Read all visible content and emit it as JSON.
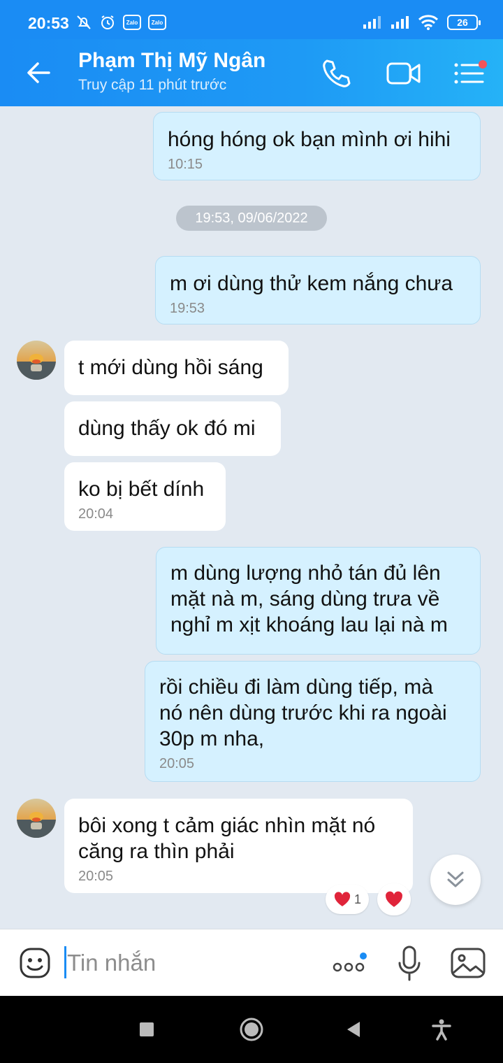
{
  "status_bar": {
    "time": "20:53",
    "app_badges": [
      "Zalo",
      "Zalo"
    ],
    "battery": "26"
  },
  "header": {
    "contact_name": "Phạm Thị Mỹ Ngân",
    "status": "Truy cập 11 phút trước",
    "icons": [
      "back-arrow-icon",
      "phone-call-icon",
      "video-call-icon",
      "menu-icon"
    ],
    "accent_color": "#1a8cf4",
    "notification_dot_color": "#f2545b"
  },
  "messages": [
    {
      "direction": "sent",
      "text": "hóng hóng ok bạn mình ơi hihi",
      "time": "10:15"
    },
    {
      "direction": "divider",
      "text": "19:53, 09/06/2022"
    },
    {
      "direction": "sent",
      "text": "m ơi dùng thử kem nắng chưa",
      "time": "19:53"
    },
    {
      "direction": "received",
      "text": "t mới dùng hồi sáng",
      "time": ""
    },
    {
      "direction": "received",
      "text": "dùng thấy ok đó mi",
      "time": ""
    },
    {
      "direction": "received",
      "text": "ko bị bết dính",
      "time": "20:04"
    },
    {
      "direction": "sent",
      "text": "m dùng lượng nhỏ tán đủ lên\nmặt nà m, sáng dùng trưa về\nnghỉ m xịt khoáng lau lại nà m",
      "time": ""
    },
    {
      "direction": "sent",
      "text": "rồi chiều đi làm dùng tiếp, mà\nnó nên dùng trước khi ra ngoài\n30p m nha,",
      "time": "20:05"
    },
    {
      "direction": "received",
      "text": "bôi xong t cảm giác nhìn mặt nó\ncăng ra thìn phải",
      "time": "20:05"
    }
  ],
  "reactions": {
    "count": "1",
    "icon": "heart-icon",
    "color": "#e0243a"
  },
  "composer": {
    "placeholder": "Tin nhắn"
  },
  "colors": {
    "sent_bubble": "#d5f1ff",
    "received_bubble": "#ffffff",
    "chat_background": "#e2e9f1"
  }
}
